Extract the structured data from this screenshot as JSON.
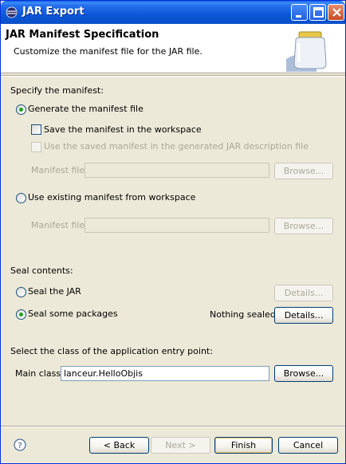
{
  "window": {
    "title": "JAR Export"
  },
  "banner": {
    "title": "JAR Manifest Specification",
    "description": "Customize the manifest file for the JAR file."
  },
  "manifest": {
    "section_label": "Specify the manifest:",
    "generate_label": "Generate the manifest file",
    "generate_selected": true,
    "save_label": "Save the manifest in the workspace",
    "save_checked": false,
    "use_saved_label": "Use the saved manifest in the generated JAR description file",
    "use_saved_enabled": false,
    "manifest_file_label": "Manifest file:",
    "manifest_file_value": "",
    "browse_label": "Browse...",
    "use_existing_label": "Use existing manifest from workspace",
    "use_existing_selected": false,
    "manifest_file2_label": "Manifest file:",
    "manifest_file2_value": "",
    "browse2_label": "Browse..."
  },
  "seal": {
    "section_label": "Seal contents:",
    "seal_jar_label": "Seal the JAR",
    "seal_jar_selected": false,
    "details1_label": "Details...",
    "seal_some_label": "Seal some packages",
    "seal_some_selected": true,
    "status_text": "Nothing sealed",
    "details2_label": "Details..."
  },
  "entry": {
    "section_label": "Select the class of the application entry point:",
    "main_class_label": "Main class:",
    "main_class_value": "lanceur.HelloObjis",
    "browse_label": "Browse..."
  },
  "footer": {
    "back_label": "< Back",
    "next_label": "Next >",
    "finish_label": "Finish",
    "cancel_label": "Cancel"
  },
  "icons": [
    "eclipse-window-icon",
    "minimize-icon",
    "maximize-icon",
    "close-icon",
    "jar-banner-icon",
    "help-icon"
  ],
  "colors": {
    "titlebar": "#0a5ce8",
    "dialog_bg": "#ece9d8",
    "disabled_text": "#aca899",
    "radio_dot": "#21a121"
  }
}
